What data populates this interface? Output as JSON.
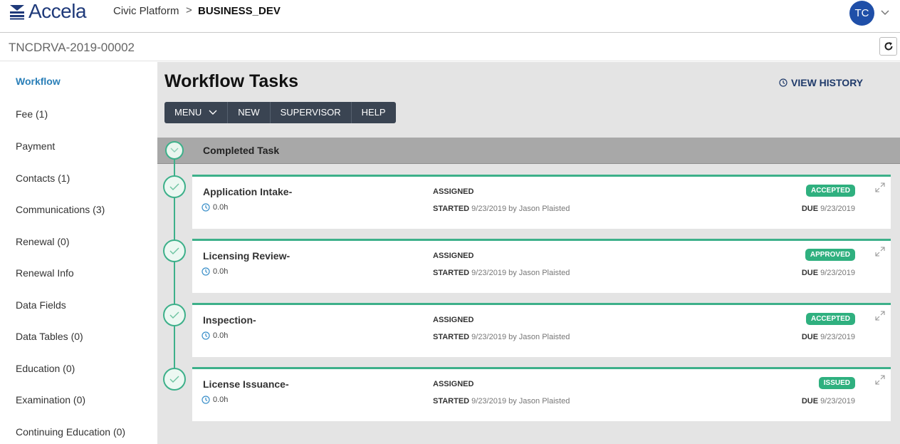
{
  "header": {
    "logo_text": "Accela",
    "platform": "Civic Platform",
    "separator": ">",
    "environment": "BUSINESS_DEV",
    "avatar_initials": "TC"
  },
  "record": {
    "id": "TNCDRVA-2019-00002"
  },
  "sidebar": {
    "items": [
      {
        "label": "Workflow",
        "active": true
      },
      {
        "label": "Fee (1)"
      },
      {
        "label": "Payment"
      },
      {
        "label": "Contacts (1)"
      },
      {
        "label": "Communications (3)"
      },
      {
        "label": "Renewal (0)"
      },
      {
        "label": "Renewal Info"
      },
      {
        "label": "Data Fields"
      },
      {
        "label": "Data Tables (0)"
      },
      {
        "label": "Education (0)"
      },
      {
        "label": "Examination (0)"
      },
      {
        "label": "Continuing Education (0)"
      }
    ]
  },
  "main": {
    "title": "Workflow Tasks",
    "view_history": "VIEW HISTORY",
    "toolbar": {
      "menu": "MENU",
      "new": "NEW",
      "supervisor": "SUPERVISOR",
      "help": "HELP"
    },
    "section_label": "Completed Task",
    "tasks": [
      {
        "name": "Application Intake-",
        "duration": "0.0h",
        "assigned_label": "ASSIGNED",
        "started_label": "STARTED",
        "started_value": "9/23/2019 by Jason Plaisted",
        "status": "ACCEPTED",
        "due_label": "DUE",
        "due_value": "9/23/2019"
      },
      {
        "name": "Licensing Review-",
        "duration": "0.0h",
        "assigned_label": "ASSIGNED",
        "started_label": "STARTED",
        "started_value": "9/23/2019 by Jason Plaisted",
        "status": "APPROVED",
        "due_label": "DUE",
        "due_value": "9/23/2019"
      },
      {
        "name": "Inspection-",
        "duration": "0.0h",
        "assigned_label": "ASSIGNED",
        "started_label": "STARTED",
        "started_value": "9/23/2019 by Jason Plaisted",
        "status": "ACCEPTED",
        "due_label": "DUE",
        "due_value": "9/23/2019"
      },
      {
        "name": "License Issuance-",
        "duration": "0.0h",
        "assigned_label": "ASSIGNED",
        "started_label": "STARTED",
        "started_value": "9/23/2019 by Jason Plaisted",
        "status": "ISSUED",
        "due_label": "DUE",
        "due_value": "9/23/2019"
      }
    ]
  },
  "colors": {
    "brand": "#1f3a7a",
    "accent_green": "#3db08a",
    "toolbar_bg": "#3a4452",
    "avatar_bg": "#1f4fa8"
  },
  "icons": {
    "logo": "accela-lines-icon",
    "refresh": "refresh-icon",
    "clock": "clock-icon",
    "check": "check-icon",
    "expand": "expand-icon",
    "chevron": "chevron-down-icon"
  }
}
